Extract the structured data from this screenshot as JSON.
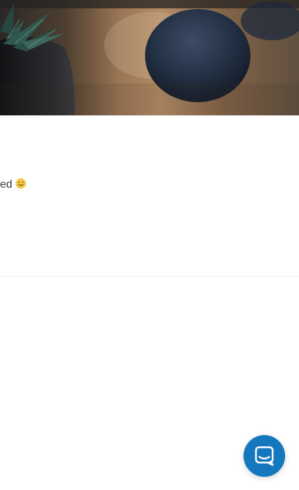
{
  "message": {
    "text": "ed",
    "emoji": "smile-icon"
  },
  "hero": {
    "image": "plant-and-dark-pots"
  },
  "launcher": {
    "icon": "chat-icon",
    "accent": "#1578bf"
  },
  "colors": {
    "text": "#3b3b3b",
    "divider": "#e8e8e8",
    "launcher": "#1578bf"
  }
}
